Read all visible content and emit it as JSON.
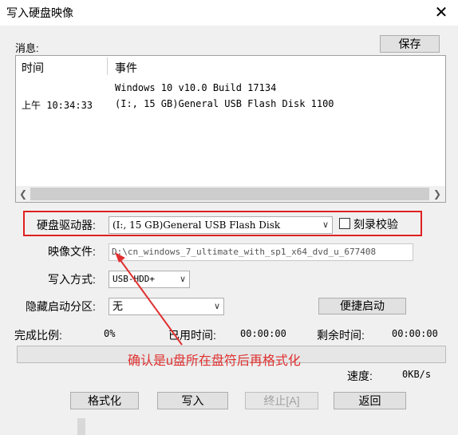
{
  "window": {
    "title": "写入硬盘映像"
  },
  "log": {
    "label": "消息:",
    "save_button": "保存",
    "col_time": "时间",
    "col_event": "事件",
    "rows": [
      {
        "time": "",
        "event": "Windows 10 v10.0 Build 17134"
      },
      {
        "time": "上午 10:34:33",
        "event": "(I:, 15 GB)General USB Flash Disk  1100"
      }
    ]
  },
  "drive": {
    "label": "硬盘驱动器:",
    "value": "(I:, 15 GB)General USB Flash Disk",
    "verify_label": "刻录校验"
  },
  "image_file": {
    "label": "映像文件:",
    "value": "D:\\cn_windows_7_ultimate_with_sp1_x64_dvd_u_677408"
  },
  "write_mode": {
    "label": "写入方式:",
    "value": "USB-HDD+"
  },
  "hidden_partition": {
    "label": "隐藏启动分区:",
    "value": "无",
    "quick_boot_button": "便捷启动"
  },
  "status": {
    "progress_label": "完成比例:",
    "progress_value": "0%",
    "elapsed_label": "已用时间:",
    "elapsed_value": "00:00:00",
    "remaining_label": "剩余时间:",
    "remaining_value": "00:00:00",
    "speed_label": "速度:",
    "speed_value": "0KB/s",
    "progress_fraction": 0
  },
  "buttons": {
    "format": "格式化",
    "write": "写入",
    "stop": "终止[A]",
    "back": "返回"
  },
  "annotation": {
    "text": "确认是u盘所在盘符后再格式化",
    "color": "#e03030"
  }
}
